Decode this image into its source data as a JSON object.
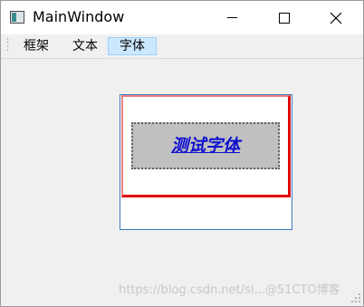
{
  "window": {
    "title": "MainWindow"
  },
  "menu": {
    "items": [
      {
        "label": "框架"
      },
      {
        "label": "文本"
      },
      {
        "label": "字体"
      }
    ],
    "active_index": 2
  },
  "content": {
    "font_sample_text": "测试字体"
  },
  "watermark": {
    "text": "https://blog.csdn.net/si...@51CTO博客"
  },
  "icons": {
    "app": "window-icon",
    "minimize": "minimize-icon",
    "maximize": "maximize-icon",
    "close": "close-icon",
    "size_grip": "size-grip-icon"
  },
  "colors": {
    "titlebar_bg": "#ffffff",
    "client_bg": "#f0f0f0",
    "menu_active_bg": "#cce8ff",
    "menu_active_border": "#99d1ff",
    "frame_border": "#3a7bbf",
    "inner_frame_border": "#e00000",
    "label_bg": "#c0c0c0",
    "label_text": "#1010d0"
  }
}
